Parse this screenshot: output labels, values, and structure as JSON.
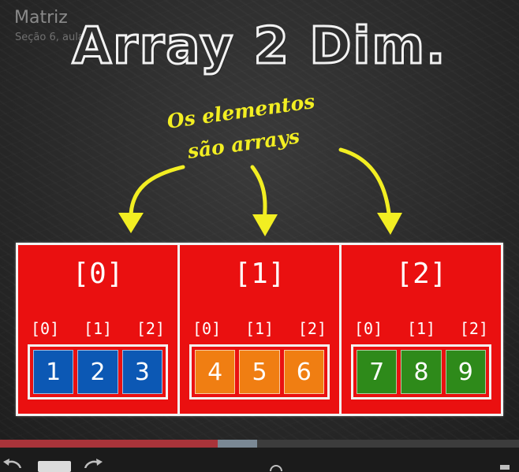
{
  "header": {
    "title": "Matriz",
    "subtitle": "Seção 6, aula"
  },
  "board": {
    "title": "Array 2 Dim.",
    "caption_line1": "Os elementos",
    "caption_line2": "são arrays"
  },
  "rows": [
    {
      "index": "[0]",
      "sub_indexes": [
        "[0]",
        "[1]",
        "[2]"
      ],
      "values": [
        "1",
        "2",
        "3"
      ],
      "color": "#0c58b4"
    },
    {
      "index": "[1]",
      "sub_indexes": [
        "[0]",
        "[1]",
        "[2]"
      ],
      "values": [
        "4",
        "5",
        "6"
      ],
      "color": "#f07e12"
    },
    {
      "index": "[2]",
      "sub_indexes": [
        "[0]",
        "[1]",
        "[2]"
      ],
      "values": [
        "7",
        "8",
        "9"
      ],
      "color": "#2e8a1a"
    }
  ],
  "colors": {
    "outer_fill": "#ea1010",
    "chalk_yellow": "#f2ee22",
    "progress_played": "#a8343a"
  },
  "player": {
    "progress_played_fraction": 0.42,
    "progress_buffered_fraction": 0.495,
    "icons": [
      "rewind-icon",
      "forward-icon",
      "fullscreen-icon"
    ]
  }
}
